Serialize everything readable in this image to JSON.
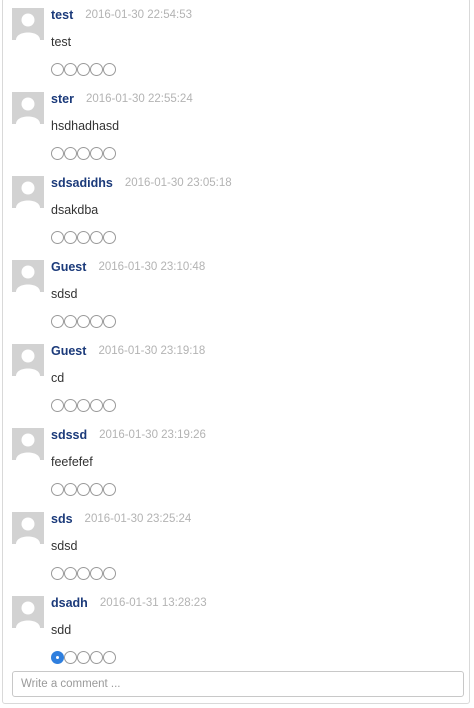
{
  "comments": [
    {
      "author": "test",
      "time": "2016-01-30 22:54:53",
      "text": "test",
      "rating": 0
    },
    {
      "author": "ster",
      "time": "2016-01-30 22:55:24",
      "text": "hsdhadhasd",
      "rating": 0
    },
    {
      "author": "sdsadidhs",
      "time": "2016-01-30 23:05:18",
      "text": "dsakdba",
      "rating": 0
    },
    {
      "author": "Guest",
      "time": "2016-01-30 23:10:48",
      "text": "sdsd",
      "rating": 0
    },
    {
      "author": "Guest",
      "time": "2016-01-30 23:19:18",
      "text": "cd",
      "rating": 0
    },
    {
      "author": "sdssd",
      "time": "2016-01-30 23:19:26",
      "text": "feefefef",
      "rating": 0
    },
    {
      "author": "sds",
      "time": "2016-01-30 23:25:24",
      "text": "sdsd",
      "rating": 0
    },
    {
      "author": "dsadh",
      "time": "2016-01-31 13:28:23",
      "text": "sdd",
      "rating": 1
    }
  ],
  "rating_max": 5,
  "comment_input": {
    "placeholder": "Write a comment ...",
    "value": ""
  },
  "colors": {
    "author": "#1b3a7a",
    "timestamp": "#b3b3b3",
    "rating_selected": "#2f7fde"
  },
  "icons": {
    "avatar": "default-user-avatar-icon"
  }
}
